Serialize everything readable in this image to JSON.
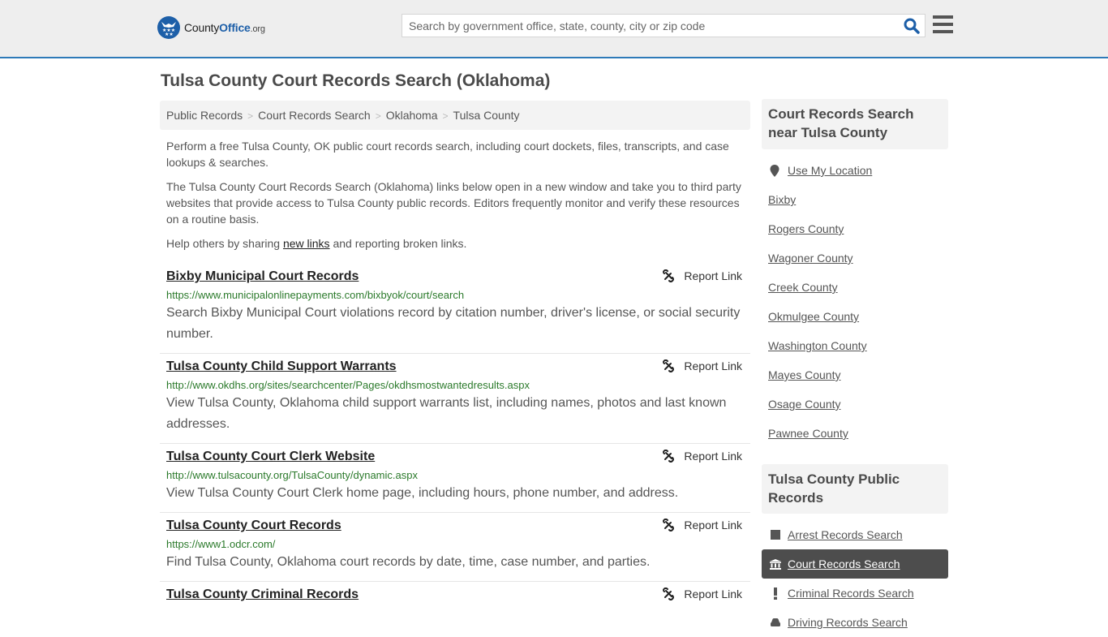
{
  "header": {
    "logo": {
      "part1": "County",
      "part2": "Office",
      "part3": ".org",
      "icon": "eagle-stars-badge-icon"
    },
    "search": {
      "placeholder": "Search by government office, state, county, city or zip code",
      "value": ""
    },
    "search_icon": "search-icon",
    "menu_icon": "hamburger-menu-icon"
  },
  "colors": {
    "brand_blue": "#1d5fa8",
    "header_border": "#2e7ab8",
    "url_green": "#2b7a2b",
    "active_item_bg": "#4d4d4d"
  },
  "page": {
    "title": "Tulsa County Court Records Search (Oklahoma)",
    "breadcrumb": [
      "Public Records",
      "Court Records Search",
      "Oklahoma",
      "Tulsa County"
    ],
    "intro": {
      "p1": "Perform a free Tulsa County, OK public court records search, including court dockets, files, transcripts, and case lookups & searches.",
      "p2": "The Tulsa County Court Records Search (Oklahoma) links below open in a new window and take you to third party websites that provide access to Tulsa County public records. Editors frequently monitor and verify these resources on a routine basis.",
      "p3_before": "Help others by sharing ",
      "p3_link": "new links",
      "p3_after": " and reporting broken links."
    },
    "report_label": "Report Link",
    "results": [
      {
        "title": "Bixby Municipal Court Records",
        "url": "https://www.municipalonlinepayments.com/bixbyok/court/search",
        "desc": "Search Bixby Municipal Court violations record by citation number, driver's license, or social security number."
      },
      {
        "title": "Tulsa County Child Support Warrants",
        "url": "http://www.okdhs.org/sites/searchcenter/Pages/okdhsmostwantedresults.aspx",
        "desc": "View Tulsa County, Oklahoma child support warrants list, including names, photos and last known addresses."
      },
      {
        "title": "Tulsa County Court Clerk Website",
        "url": "http://www.tulsacounty.org/TulsaCounty/dynamic.aspx",
        "desc": "View Tulsa County Court Clerk home page, including hours, phone number, and address."
      },
      {
        "title": "Tulsa County Court Records",
        "url": "https://www1.odcr.com/",
        "desc": "Find Tulsa County, Oklahoma court records by date, time, case number, and parties."
      },
      {
        "title": "Tulsa County Criminal Records",
        "url": "",
        "desc": ""
      }
    ]
  },
  "sidebar": {
    "nearby": {
      "title": "Court Records Search near Tulsa County",
      "use_location": "Use My Location",
      "items": [
        "Bixby",
        "Rogers County",
        "Wagoner County",
        "Creek County",
        "Okmulgee County",
        "Washington County",
        "Mayes County",
        "Osage County",
        "Pawnee County"
      ]
    },
    "public_records": {
      "title": "Tulsa County Public Records",
      "items": [
        {
          "label": "Arrest Records Search",
          "icon": "square-icon",
          "active": false
        },
        {
          "label": "Court Records Search",
          "icon": "courthouse-icon",
          "active": true
        },
        {
          "label": "Criminal Records Search",
          "icon": "exclamation-icon",
          "active": false
        },
        {
          "label": "Driving Records Search",
          "icon": "car-icon",
          "active": false
        }
      ]
    }
  }
}
